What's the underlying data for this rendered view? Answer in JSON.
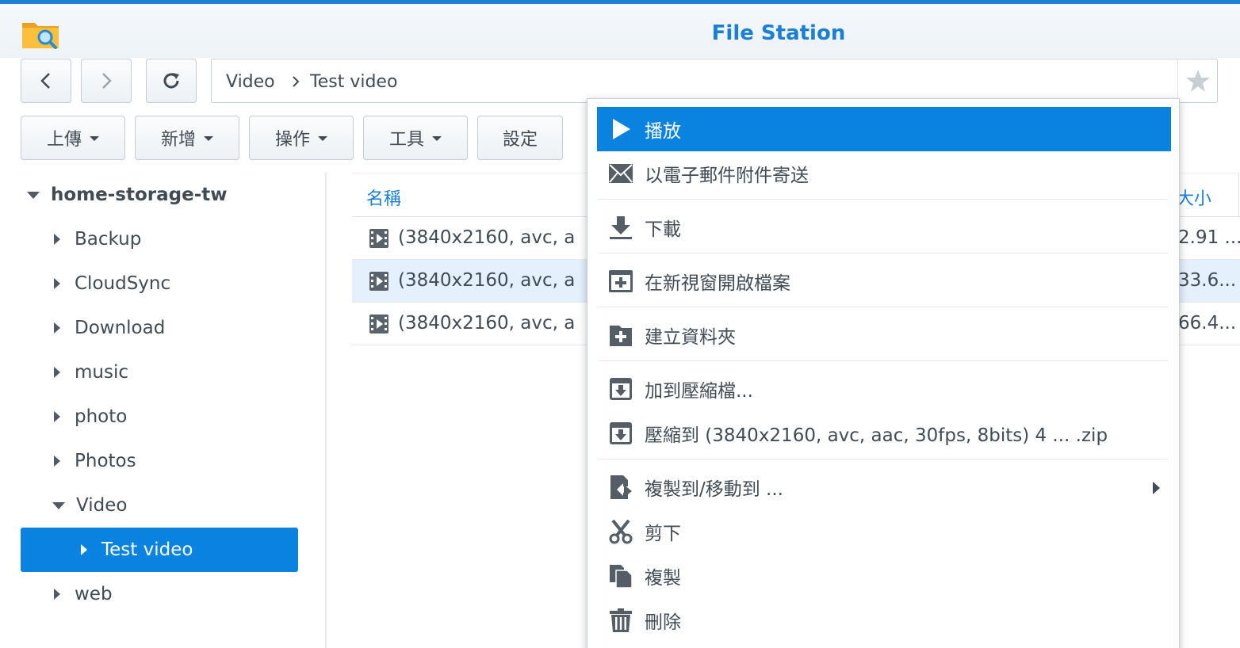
{
  "app": {
    "title": "File Station"
  },
  "path": {
    "crumbs": [
      "Video",
      "Test video"
    ]
  },
  "toolbar": {
    "upload": "上傳",
    "create": "新增",
    "action": "操作",
    "tools": "工具",
    "settings": "設定"
  },
  "tree": {
    "root": "home-storage-tw",
    "items": [
      "Backup",
      "CloudSync",
      "Download",
      "music",
      "photo",
      "Photos",
      "Video",
      "Test video",
      "web"
    ],
    "selected": "Test video"
  },
  "file_list": {
    "columns": {
      "name": "名稱",
      "size": "大小"
    },
    "rows": [
      {
        "name": "(3840x2160, avc, a",
        "size": "2.91 ..."
      },
      {
        "name": "(3840x2160, avc, a",
        "size": "33.6..."
      },
      {
        "name": "(3840x2160, avc, a",
        "size": "66.4..."
      }
    ]
  },
  "context_menu": {
    "items": [
      {
        "label": "播放",
        "icon": "play-icon"
      },
      {
        "label": "以電子郵件附件寄送",
        "icon": "mail-icon"
      },
      {
        "label": "下載",
        "icon": "download-icon"
      },
      {
        "label": "在新視窗開啟檔案",
        "icon": "open-new-window-icon"
      },
      {
        "label": "建立資料夾",
        "icon": "create-folder-icon"
      },
      {
        "label": "加到壓縮檔...",
        "icon": "archive-icon"
      },
      {
        "label": "壓縮到 (3840x2160, avc, aac, 30fps, 8bits) 4 ... .zip",
        "icon": "archive-icon"
      },
      {
        "label": "複製到/移動到 ...",
        "icon": "copy-move-icon"
      },
      {
        "label": "剪下",
        "icon": "scissors-icon"
      },
      {
        "label": "複製",
        "icon": "copy-icon"
      },
      {
        "label": "刪除",
        "icon": "trash-icon"
      }
    ]
  },
  "colors": {
    "accent": "#0a82e0",
    "title": "#1a7fd6",
    "text": "#414b55"
  }
}
